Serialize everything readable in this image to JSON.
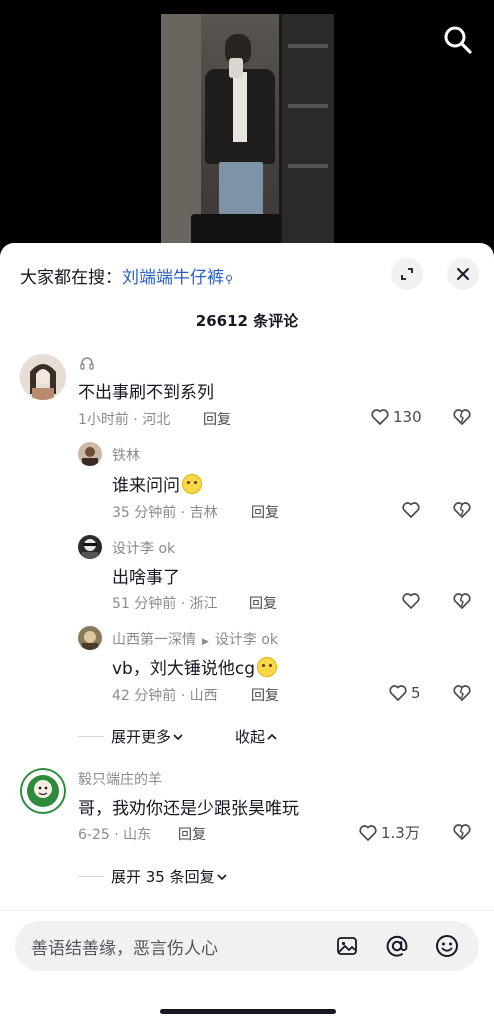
{
  "search_bar": {
    "prefix": "大家都在搜：",
    "query": "刘端端牛仔裤"
  },
  "comments_header": {
    "count_label": "26612 条评论"
  },
  "comments": [
    {
      "name": "",
      "text": "不出事刷不到系列",
      "meta": "1小时前 · 河北",
      "reply_label": "回复",
      "likes": "130"
    },
    {
      "name": "铁林",
      "text": "谁来问问",
      "meta": "35 分钟前 · 吉林",
      "reply_label": "回复",
      "likes": ""
    },
    {
      "name": "设计李 ok",
      "text": "出啥事了",
      "meta": "51 分钟前 · 浙江",
      "reply_label": "回复",
      "likes": ""
    },
    {
      "name": "山西第一深情",
      "reply_to": "设计李 ok",
      "text": "vb，刘大锤说他cg",
      "meta": "42 分钟前 · 山西",
      "reply_label": "回复",
      "likes": "5"
    },
    {
      "name": "毅只端庄的羊",
      "text": "哥，我劝你还是少跟张昊唯玩",
      "meta": "6-25 · 山东",
      "reply_label": "回复",
      "likes": "1.3万"
    }
  ],
  "thread_controls": {
    "expand_more": "展开更多",
    "collapse": "收起",
    "expand_replies": "展开 35 条回复"
  },
  "input": {
    "placeholder": "善语结善缘，恶言伤人心"
  },
  "icons": {
    "search": "search-icon",
    "fullscreen": "fullscreen-icon",
    "close": "close-icon",
    "like": "heart-icon",
    "dislike": "broken-heart-icon",
    "image": "image-icon",
    "mention": "at-icon",
    "emoji": "emoji-icon"
  },
  "colors": {
    "link": "#2a5ec9",
    "secondary_text": "#8a8b91"
  }
}
